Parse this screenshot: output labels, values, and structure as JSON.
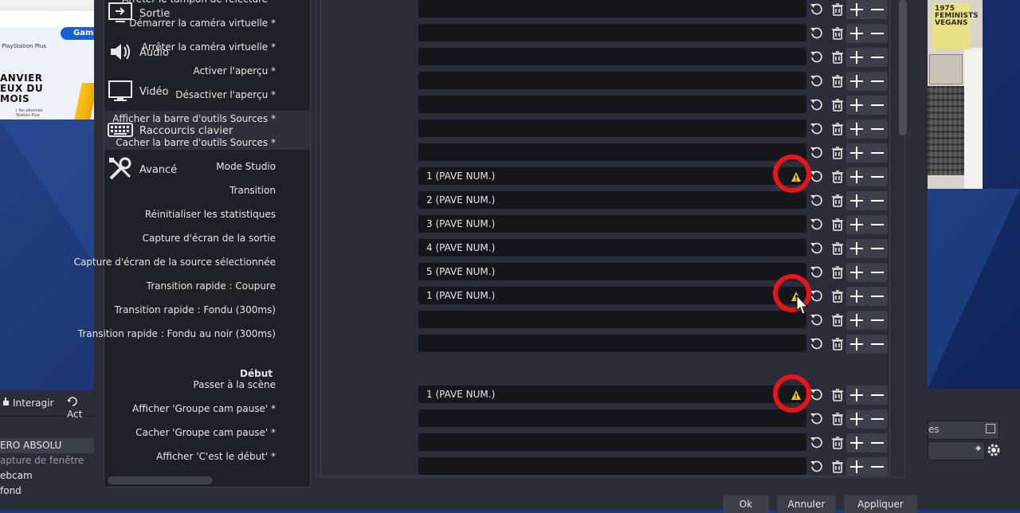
{
  "background": {
    "left_browser": {
      "button_gam": "Gam",
      "ps_plus": "PlayStation Plus",
      "promo_title_1": "ANVIER",
      "promo_title_2": "EUX DU",
      "promo_title_3": "MOIS",
      "promo_note": "r les abonnés\nStation Plus"
    },
    "left_toolbar": {
      "interact_label": "Interagir",
      "act_label": "Act"
    },
    "sources": [
      {
        "label": "ERO ABSOLU",
        "selected": true
      },
      {
        "label": "apture de fenêtre",
        "dim": true
      },
      {
        "label": "ebcam"
      },
      {
        "label": " fond"
      }
    ],
    "right_cam_poster": "1975\nFEMINISTS\nVEGANS",
    "right_panel": {
      "label_s": "es",
      "gear_icon": "gear-icon"
    }
  },
  "sidebar": {
    "items": [
      {
        "id": "output",
        "label": "Sortie",
        "icon": "output-icon"
      },
      {
        "id": "audio",
        "label": "Audio",
        "icon": "speaker-icon"
      },
      {
        "id": "video",
        "label": "Vidéo",
        "icon": "monitor-icon"
      },
      {
        "id": "hotkeys",
        "label": "Raccourcis clavier",
        "icon": "keyboard-icon",
        "active": true
      },
      {
        "id": "advanced",
        "label": "Avancé",
        "icon": "tools-icon"
      }
    ]
  },
  "hotkeys": {
    "rows": [
      {
        "label": "Arrêter le tampon de relecture *",
        "value": ""
      },
      {
        "label": "Démarrer la caméra virtuelle *",
        "value": ""
      },
      {
        "label": "Arrêter la caméra virtuelle *",
        "value": ""
      },
      {
        "label": "Activer l'aperçu *",
        "value": ""
      },
      {
        "label": "Désactiver l'aperçu *",
        "value": ""
      },
      {
        "label": "Afficher la barre d'outils Sources *",
        "value": ""
      },
      {
        "label": "Cacher la barre d'outils Sources *",
        "value": ""
      },
      {
        "label": "Mode Studio",
        "value": "1 (PAVE NUM.)",
        "warning": true
      },
      {
        "label": "Transition",
        "value": "2 (PAVE NUM.)"
      },
      {
        "label": "Réinitialiser les statistiques",
        "value": "3 (PAVE NUM.)"
      },
      {
        "label": "Capture d'écran de la sortie",
        "value": "4 (PAVE NUM.)"
      },
      {
        "label": "Capture d'écran de la source sélectionnée",
        "value": "5 (PAVE NUM.)"
      },
      {
        "label": "Transition rapide : Coupure",
        "value": "1 (PAVE NUM.)",
        "warning": true
      },
      {
        "label": "Transition rapide : Fondu (300ms)",
        "value": ""
      },
      {
        "label": "Transition rapide : Fondu au noir (300ms)",
        "value": ""
      }
    ],
    "section_debut": {
      "title": "Début",
      "rows": [
        {
          "label": "Passer à la scène",
          "value": "1 (PAVE NUM.)",
          "warning": true
        },
        {
          "label": "Afficher 'Groupe cam pause' *",
          "value": ""
        },
        {
          "label": "Cacher 'Groupe cam pause' *",
          "value": ""
        },
        {
          "label": "Afficher 'C'est le début' *",
          "value": ""
        }
      ]
    }
  },
  "buttons": {
    "ok": "Ok",
    "cancel": "Annuler",
    "apply": "Appliquer"
  },
  "colors": {
    "highlight_circle": "#e8141b",
    "warning": "#f2c418",
    "dialog_bg": "#2b2e38",
    "field_bg": "#16171c"
  }
}
